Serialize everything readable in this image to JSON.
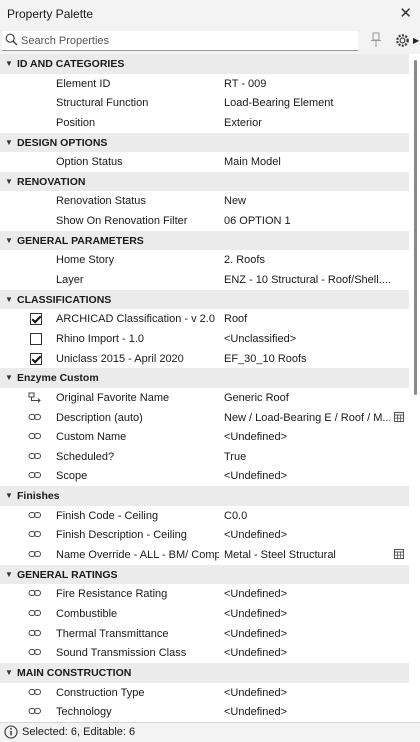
{
  "window": {
    "title": "Property Palette"
  },
  "search": {
    "placeholder": "Search Properties"
  },
  "status": {
    "text": "Selected: 6, Editable: 6"
  },
  "sections": [
    {
      "name": "ID AND CATEGORIES",
      "rows": [
        {
          "kind": "plain",
          "label": "Element ID",
          "value": "RT - 009"
        },
        {
          "kind": "plain",
          "label": "Structural Function",
          "value": "Load-Bearing Element"
        },
        {
          "kind": "plain",
          "label": "Position",
          "value": "Exterior"
        }
      ]
    },
    {
      "name": "DESIGN OPTIONS",
      "rows": [
        {
          "kind": "plain",
          "label": "Option Status",
          "value": "Main Model"
        }
      ]
    },
    {
      "name": "RENOVATION",
      "rows": [
        {
          "kind": "plain",
          "label": "Renovation Status",
          "value": "New"
        },
        {
          "kind": "plain",
          "label": "Show On Renovation Filter",
          "value": "06 OPTION 1"
        }
      ]
    },
    {
      "name": "GENERAL PARAMETERS",
      "rows": [
        {
          "kind": "plain",
          "label": "Home Story",
          "value": "2. Roofs"
        },
        {
          "kind": "plain",
          "label": "Layer",
          "value": "ENZ - 10 Structural - Roof/Shell...."
        }
      ]
    },
    {
      "name": "CLASSIFICATIONS",
      "rows": [
        {
          "kind": "check",
          "checked": true,
          "label": "ARCHICAD Classification - v 2.0",
          "value": "Roof"
        },
        {
          "kind": "check",
          "checked": false,
          "label": "Rhino Import - 1.0",
          "value": "<Unclassified>"
        },
        {
          "kind": "check",
          "checked": true,
          "label": "Uniclass 2015 - April 2020",
          "value": "EF_30_10 Roofs"
        }
      ]
    },
    {
      "name": "Enzyme Custom",
      "rows": [
        {
          "kind": "fav",
          "label": "Original Favorite Name",
          "value": "Generic Roof"
        },
        {
          "kind": "link",
          "label": "Description (auto)",
          "value": "New / Load-Bearing E / Roof / M...",
          "calc": true
        },
        {
          "kind": "link",
          "label": "Custom Name",
          "value": "<Undefined>"
        },
        {
          "kind": "link",
          "label": "Scheduled?",
          "value": "True"
        },
        {
          "kind": "link",
          "label": "Scope",
          "value": "<Undefined>"
        }
      ]
    },
    {
      "name": "Finishes",
      "rows": [
        {
          "kind": "link",
          "label": "Finish Code - Ceiling",
          "value": "C0.0"
        },
        {
          "kind": "link",
          "label": "Finish Description - Ceiling",
          "value": "<Undefined>"
        },
        {
          "kind": "link",
          "label": "Name Override - ALL - BM/ Comp...",
          "value": "Metal - Steel Structural",
          "calc": true
        }
      ]
    },
    {
      "name": "GENERAL RATINGS",
      "rows": [
        {
          "kind": "link",
          "label": "Fire Resistance Rating",
          "value": "<Undefined>"
        },
        {
          "kind": "link",
          "label": "Combustible",
          "value": "<Undefined>"
        },
        {
          "kind": "link",
          "label": "Thermal Transmittance",
          "value": "<Undefined>"
        },
        {
          "kind": "link",
          "label": "Sound Transmission Class",
          "value": "<Undefined>"
        }
      ]
    },
    {
      "name": "MAIN CONSTRUCTION",
      "rows": [
        {
          "kind": "link",
          "label": "Construction Type",
          "value": "<Undefined>"
        },
        {
          "kind": "link",
          "label": "Technology",
          "value": "<Undefined>"
        }
      ]
    }
  ]
}
